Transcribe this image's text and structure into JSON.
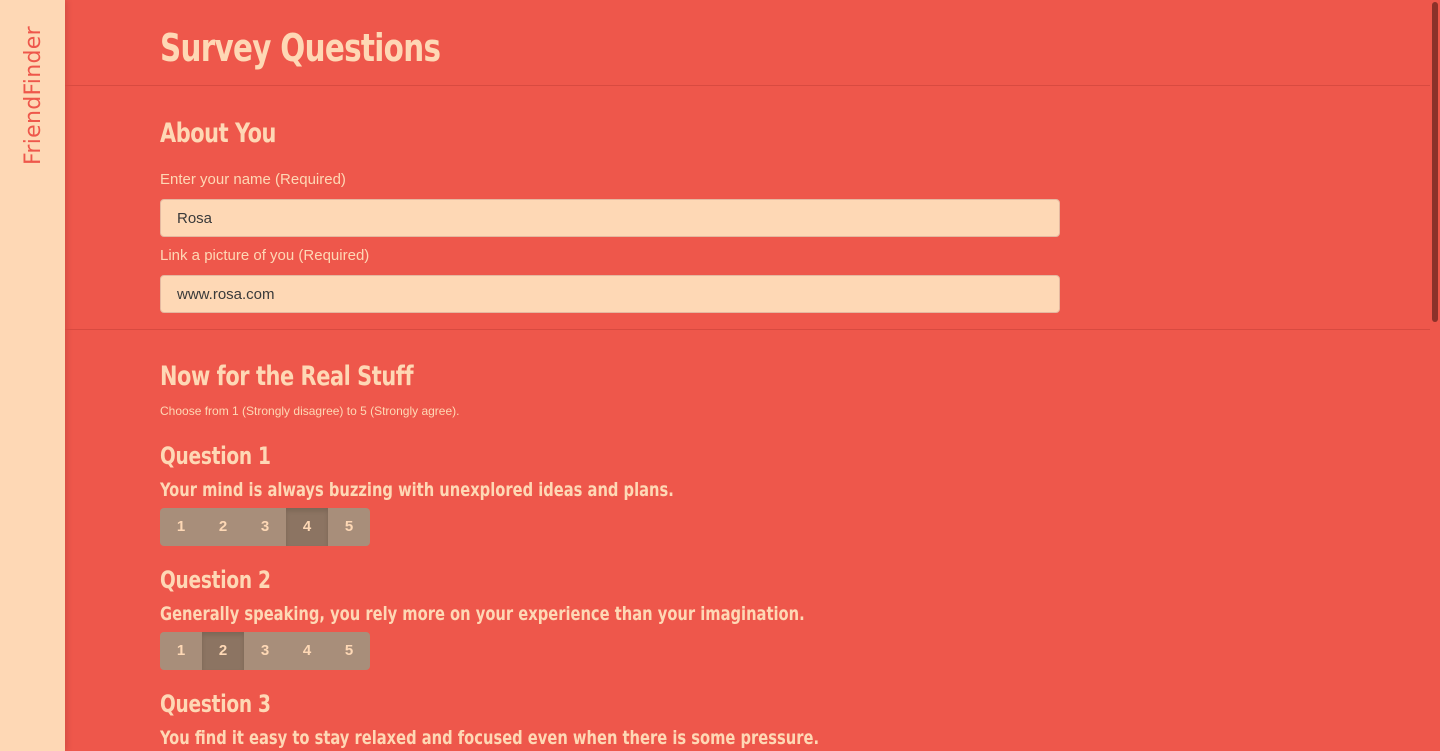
{
  "brand": "FriendFinder",
  "page_title": "Survey Questions",
  "about": {
    "title": "About You",
    "name_label": "Enter your name (Required)",
    "name_value": "Rosa",
    "photo_label": "Link a picture of you (Required)",
    "photo_value": "www.rosa.com"
  },
  "real_stuff": {
    "title": "Now for the Real Stuff",
    "hint": "Choose from 1 (Strongly disagree) to 5 (Strongly agree)."
  },
  "options": [
    "1",
    "2",
    "3",
    "4",
    "5"
  ],
  "questions": [
    {
      "title": "Question 1",
      "text": "Your mind is always buzzing with unexplored ideas and plans.",
      "selected": "4"
    },
    {
      "title": "Question 2",
      "text": "Generally speaking, you rely more on your experience than your imagination.",
      "selected": "2"
    },
    {
      "title": "Question 3",
      "text": "You find it easy to stay relaxed and focused even when there is some pressure.",
      "selected": null
    }
  ],
  "colors": {
    "background": "#ee574b",
    "sidebar": "#fed8b5",
    "accent_text": "#fed8b5",
    "option_bg": "#a88e7a",
    "option_active": "#8c7462"
  }
}
